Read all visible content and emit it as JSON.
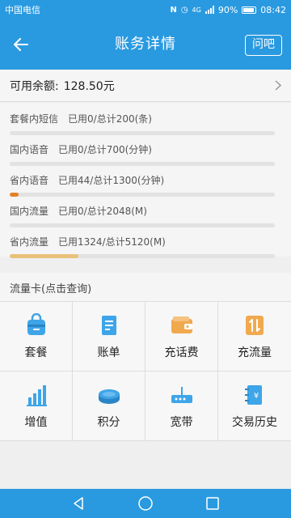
{
  "status_bar": {
    "carrier": "中国电信",
    "network": "4G",
    "battery": "90%",
    "time": "08:42"
  },
  "header": {
    "title": "账务详情",
    "back_icon": "back-arrow-icon",
    "ask_label": "问吧"
  },
  "balance": {
    "label": "可用余额:",
    "value": "128.50元"
  },
  "usage": [
    {
      "label": "套餐内短信",
      "used_text": "已用0/总计200(条)",
      "progress": 0.0,
      "color": "#e4802a"
    },
    {
      "label": "国内语音",
      "used_text": "已用0/总计700(分钟)",
      "progress": 0.0,
      "color": "#e4802a"
    },
    {
      "label": "省内语音",
      "used_text": "已用44/总计1300(分钟)",
      "progress": 0.034,
      "color": "#e4802a"
    },
    {
      "label": "国内流量",
      "used_text": "已用0/总计2048(M)",
      "progress": 0.0,
      "color": "#e8c27a"
    },
    {
      "label": "省内流量",
      "used_text": "已用1324/总计5120(M)",
      "progress": 0.259,
      "color": "#e8c27a"
    }
  ],
  "flow_card_label": "流量卡(点击查询)",
  "grid": [
    {
      "label": "套餐",
      "icon": "package-bag-icon"
    },
    {
      "label": "账单",
      "icon": "bill-document-icon"
    },
    {
      "label": "充话费",
      "icon": "wallet-icon"
    },
    {
      "label": "充流量",
      "icon": "data-exchange-icon"
    },
    {
      "label": "增值",
      "icon": "bar-chart-icon"
    },
    {
      "label": "积分",
      "icon": "coins-icon"
    },
    {
      "label": "宽带",
      "icon": "router-icon"
    },
    {
      "label": "交易历史",
      "icon": "transaction-history-icon"
    }
  ],
  "colors": {
    "primary": "#2a9ae0",
    "accent_orange": "#e4802a",
    "accent_gold": "#e8c27a",
    "icon_blue": "#3ea5e8",
    "icon_orange": "#f1a94e"
  }
}
